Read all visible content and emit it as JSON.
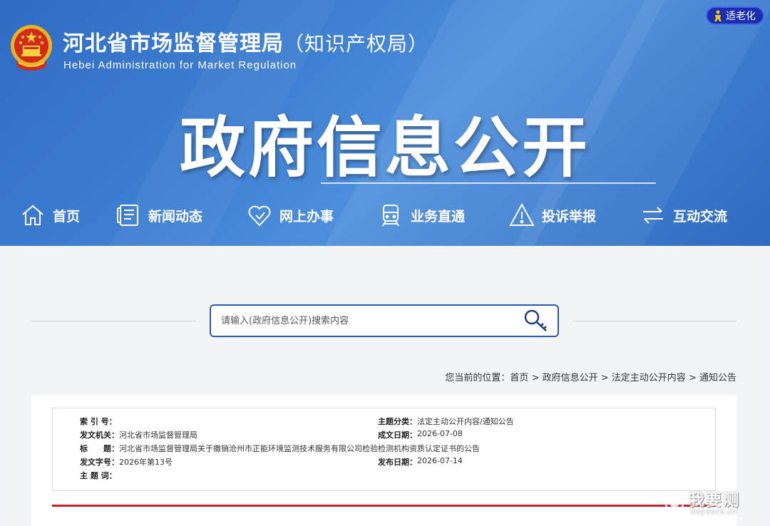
{
  "header": {
    "title": "河北省市场监督管理局",
    "title_sub": "（知识产权局）",
    "title_en": "Hebei Administration for Market Regulation",
    "elder_mode": "适老化",
    "hero": "政府信息公开"
  },
  "nav": {
    "items": [
      {
        "label": "首页",
        "icon": "home-icon"
      },
      {
        "label": "新闻动态",
        "icon": "news-icon"
      },
      {
        "label": "网上办事",
        "icon": "heart-icon"
      },
      {
        "label": "业务直通",
        "icon": "train-icon"
      },
      {
        "label": "投诉举报",
        "icon": "warning-icon"
      },
      {
        "label": "互动交流",
        "icon": "exchange-icon"
      }
    ]
  },
  "search": {
    "placeholder": "请输入(政府信息公开)搜索内容"
  },
  "breadcrumb": {
    "prefix": "您当前的位置：",
    "items": [
      "首页",
      "政府信息公开",
      "法定主动公开内容",
      "通知公告"
    ],
    "separator": " > "
  },
  "meta": {
    "index_no": {
      "label": "索 引 号：",
      "value": ""
    },
    "category": {
      "label": "主题分类：",
      "value": "法定主动公开内容/通知公告"
    },
    "issuer": {
      "label": "发文机关：",
      "value": "河北省市场监督管理局"
    },
    "date_created": {
      "label": "成文日期：",
      "value": "2026-07-08"
    },
    "title": {
      "label": "标　　题：",
      "value": "河北省市场监督管理局关于撤销沧州市正能环境监测技术服务有限公司检验检测机构资质认定证书的公告"
    },
    "doc_no": {
      "label": "发文字号：",
      "value": "2026年第13号"
    },
    "date_published": {
      "label": "发布日期：",
      "value": "2026-07-14"
    },
    "keywords": {
      "label": "主 题 词：",
      "value": ""
    }
  },
  "watermark": {
    "cn": "我要测",
    "en": "woyaoce.cn"
  },
  "colors": {
    "header_blue": "#3e7fd2",
    "search_border": "#2a5aa8",
    "elder_btn": "#1a2fb0",
    "red_rule": "#c8202a"
  }
}
